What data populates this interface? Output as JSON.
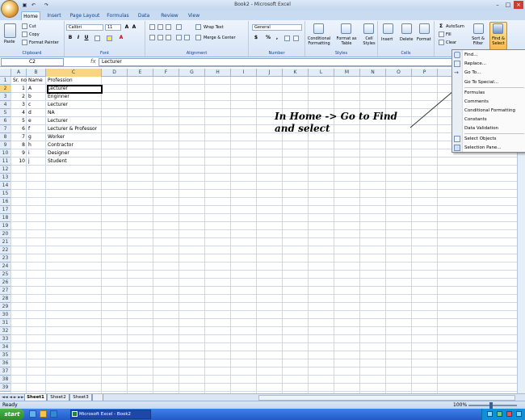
{
  "window": {
    "title": "Book2 - Microsoft Excel"
  },
  "tabs": [
    "Home",
    "Insert",
    "Page Layout",
    "Formulas",
    "Data",
    "Review",
    "View"
  ],
  "ribbon": {
    "clipboard": {
      "label": "Clipboard",
      "paste": "Paste",
      "cut": "Cut",
      "copy": "Copy",
      "format_painter": "Format Painter"
    },
    "font": {
      "label": "Font",
      "name": "Calibri",
      "size": "11"
    },
    "alignment": {
      "label": "Alignment",
      "wrap": "Wrap Text",
      "merge": "Merge & Center"
    },
    "number": {
      "label": "Number",
      "format": "General",
      "dollar": "$",
      "percent": "%",
      "comma": ","
    },
    "styles": {
      "label": "Styles",
      "cond": "Conditional Formatting",
      "table": "Format as Table",
      "cell": "Cell Styles"
    },
    "cells": {
      "label": "Cells",
      "insert": "Insert",
      "delete": "Delete",
      "format": "Format"
    },
    "editing": {
      "autosum": "AutoSum",
      "fill": "Fill",
      "clear": "Clear",
      "sort": "Sort & Filter",
      "find": "Find & Select"
    }
  },
  "formula_bar": {
    "name_box": "C2",
    "fx": "fx",
    "content": "Lecturer"
  },
  "columns": [
    "A",
    "B",
    "C",
    "D",
    "E",
    "F",
    "G",
    "H",
    "I",
    "J",
    "K",
    "L",
    "M",
    "N",
    "O",
    "P"
  ],
  "headers": {
    "a": "Sr. no",
    "b": "Name",
    "c": "Profession"
  },
  "rows": [
    {
      "n": "1",
      "name": "A",
      "prof": "Lecturer"
    },
    {
      "n": "2",
      "name": "b",
      "prof": "Enginner"
    },
    {
      "n": "3",
      "name": "c",
      "prof": "Lecturer"
    },
    {
      "n": "4",
      "name": "d",
      "prof": "NA"
    },
    {
      "n": "5",
      "name": "e",
      "prof": "Lecturer"
    },
    {
      "n": "6",
      "name": "f",
      "prof": "Lecturer & Professor"
    },
    {
      "n": "7",
      "name": "g",
      "prof": "Worker"
    },
    {
      "n": "8",
      "name": "h",
      "prof": "Contractor"
    },
    {
      "n": "9",
      "name": "i",
      "prof": "Designer"
    },
    {
      "n": "10",
      "name": "j",
      "prof": "Student"
    }
  ],
  "find_menu": [
    "Find...",
    "Replace...",
    "Go To...",
    "Go To Special...",
    "Formulas",
    "Comments",
    "Conditional Formatting",
    "Constants",
    "Data Validation",
    "Select Objects",
    "Selection Pane..."
  ],
  "annotation": {
    "line1": "In Home  -> Go to Find",
    "line2": "and select"
  },
  "sheets": [
    "Sheet1",
    "Sheet2",
    "Sheet3"
  ],
  "status": {
    "ready": "Ready",
    "zoom": "100%"
  },
  "taskbar": {
    "start": "start",
    "excel": "Microsoft Excel - Book2"
  }
}
